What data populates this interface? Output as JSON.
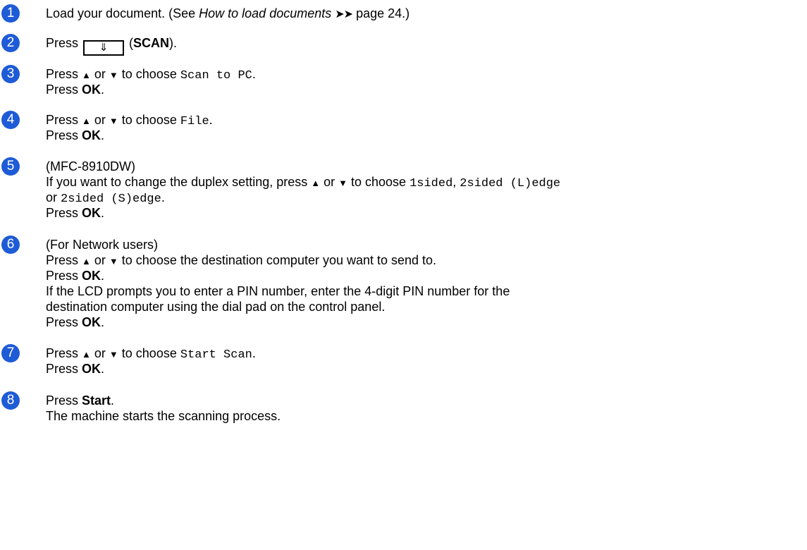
{
  "steps": [
    {
      "n": "1",
      "parts": {
        "a": "Load your document. (See ",
        "b": "How to load documents",
        "c": "➤➤",
        "d": " page 24.)"
      }
    },
    {
      "n": "2",
      "parts": {
        "a": "Press ",
        "icon": "⇓",
        "b": " (",
        "c": "SCAN",
        "d": ")."
      }
    },
    {
      "n": "3",
      "parts": {
        "a": "Press ",
        "up": "▲",
        "b": " or ",
        "down": "▼",
        "c": " to choose ",
        "d": "Scan to PC",
        "e": "."
      },
      "press": "Press ",
      "ok": "OK",
      "dot": "."
    },
    {
      "n": "4",
      "parts": {
        "a": "Press ",
        "up": "▲",
        "b": " or ",
        "down": "▼",
        "c": " to choose ",
        "d": "File",
        "e": "."
      },
      "press": "Press ",
      "ok": "OK",
      "dot": "."
    },
    {
      "n": "5",
      "model": "(MFC-8910DW)",
      "parts": {
        "a": "If you want to change the duplex setting, press ",
        "up": "▲",
        "b": " or ",
        "down": "▼",
        "c": " to choose ",
        "d": "1sided",
        "e": ", ",
        "f": "2sided (L)edge"
      },
      "line3": {
        "or": "or ",
        "opt": "2sided (S)edge",
        "dot": "."
      },
      "press": "Press ",
      "ok": "OK",
      "dot": "."
    },
    {
      "n": "6",
      "head": "(For Network users)",
      "parts": {
        "a": "Press ",
        "up": "▲",
        "b": " or ",
        "down": "▼",
        "c": " to choose the destination computer you want to send to."
      },
      "press": "Press ",
      "ok": "OK",
      "dot": ".",
      "pin1": "If the LCD prompts you to enter a PIN number, enter the 4-digit PIN number for the",
      "pin2": "destination computer using the dial pad on the control panel.",
      "press2": "Press ",
      "ok2": "OK",
      "dot2": "."
    },
    {
      "n": "7",
      "parts": {
        "a": "Press ",
        "up": "▲",
        "b": " or ",
        "down": "▼",
        "c": " to choose ",
        "d": "Start Scan",
        "e": "."
      },
      "press": "Press ",
      "ok": "OK",
      "dot": "."
    },
    {
      "n": "8",
      "press": "Press ",
      "start": "Start",
      "dot": ".",
      "desc": "The machine starts the scanning process."
    }
  ]
}
